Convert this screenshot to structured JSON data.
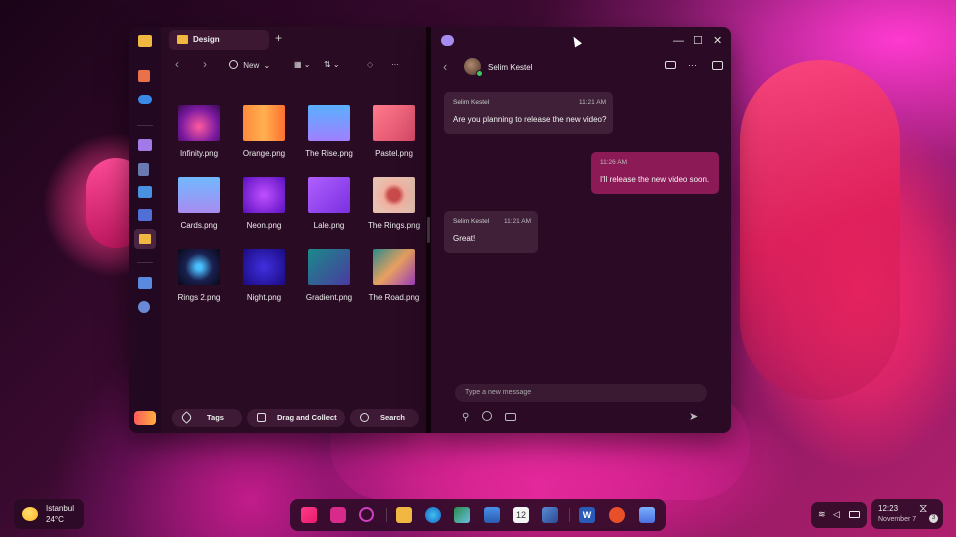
{
  "file_manager": {
    "tab_label": "Design",
    "new_label": "New",
    "files": [
      {
        "name": "Infinity.png"
      },
      {
        "name": "Orange.png"
      },
      {
        "name": "The Rise.png"
      },
      {
        "name": "Pastel.png"
      },
      {
        "name": "Cards.png"
      },
      {
        "name": "Neon.png"
      },
      {
        "name": "Lale.png"
      },
      {
        "name": "The Rings.png"
      },
      {
        "name": "Rings 2.png"
      },
      {
        "name": "Night.png"
      },
      {
        "name": "Gradient.png"
      },
      {
        "name": "The Road.png"
      }
    ],
    "bottom_buttons": {
      "tags": "Tags",
      "drag": "Drag and Collect",
      "search": "Search"
    }
  },
  "chat": {
    "contact_name": "Selim Kestel",
    "messages": [
      {
        "sender": "Selim Kestel",
        "time": "11:21 AM",
        "text": "Are you planning to release the new video?"
      },
      {
        "sender": "",
        "time": "11:26 AM",
        "text": "I'll release the new video soon."
      },
      {
        "sender": "Selim Kestel",
        "time": "11:21 AM",
        "text": "Great!"
      }
    ],
    "compose_placeholder": "Type a new message"
  },
  "weather": {
    "city": "Istanbul",
    "temp": "24°C"
  },
  "clock": {
    "time": "12:23",
    "date": "November 7",
    "notification_count": "3"
  },
  "colors": {
    "accent": "#8c1a56",
    "window_bg": "#2a0b24",
    "folder": "#f0b840"
  }
}
